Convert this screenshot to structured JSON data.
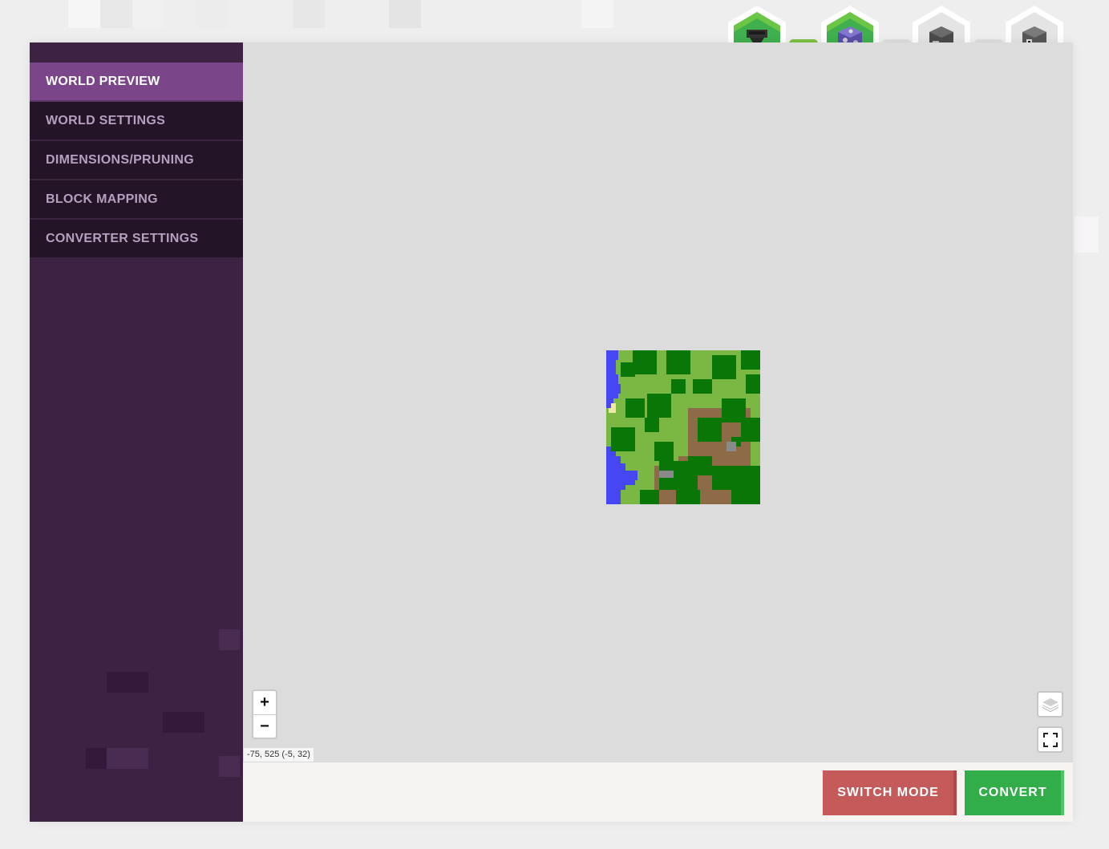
{
  "colors": {
    "sidebar_bg": "#3e2243",
    "nav_item_bg": "#231428",
    "nav_active_bg": "#7b4589",
    "map_bg": "#dddcdd",
    "switch_mode_bg": "#c45a5a",
    "convert_bg": "#32ad4a",
    "step_done": "#3fb04d",
    "step_pending": "#e4e4e4"
  },
  "progress_steps": [
    {
      "name": "hopper-icon",
      "state": "complete"
    },
    {
      "name": "command-block-icon",
      "state": "complete"
    },
    {
      "name": "furnace-icon",
      "state": "pending"
    },
    {
      "name": "dispenser-icon",
      "state": "pending"
    }
  ],
  "connectors": [
    "complete",
    "pending",
    "pending"
  ],
  "sidebar": {
    "items": [
      {
        "id": "world-preview",
        "label": "WORLD PREVIEW",
        "active": true
      },
      {
        "id": "world-settings",
        "label": "WORLD SETTINGS",
        "active": false
      },
      {
        "id": "dimensions-pruning",
        "label": "DIMENSIONS/PRUNING",
        "active": false
      },
      {
        "id": "block-mapping",
        "label": "BLOCK MAPPING",
        "active": false
      },
      {
        "id": "converter-settings",
        "label": "CONVERTER SETTINGS",
        "active": false
      }
    ]
  },
  "map": {
    "zoom_in_label": "+",
    "zoom_out_label": "−",
    "coordinates": "-75, 525 (-5, 32)",
    "layers_icon": "layers-icon",
    "fullscreen_icon": "fullscreen-icon"
  },
  "footer": {
    "switch_mode_label": "SWITCH MODE",
    "convert_label": "CONVERT"
  }
}
